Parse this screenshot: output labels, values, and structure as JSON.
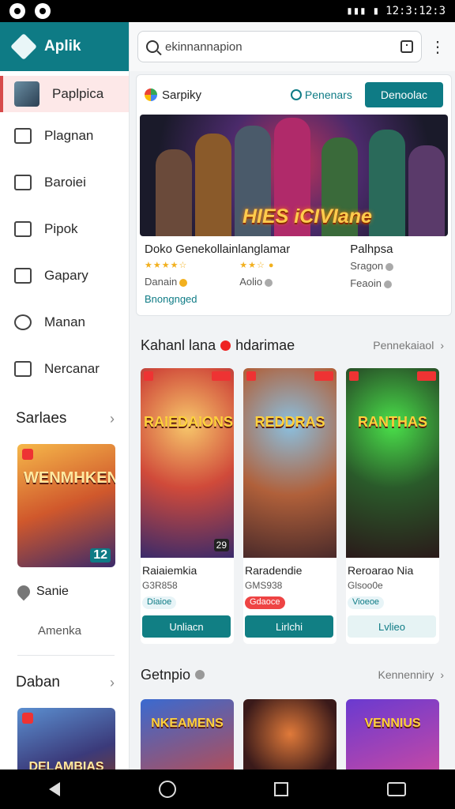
{
  "status": {
    "time": "12:3:12:3"
  },
  "sidebar": {
    "app_name": "Aplik",
    "items": [
      {
        "label": "Paplpica",
        "icon": "avatar-icon"
      },
      {
        "label": "Plagnan",
        "icon": "grid-icon"
      },
      {
        "label": "Baroiei",
        "icon": "store-icon"
      },
      {
        "label": "Pipok",
        "icon": "calendar-icon"
      },
      {
        "label": "Gapary",
        "icon": "home-icon"
      },
      {
        "label": "Manan",
        "icon": "search-icon"
      },
      {
        "label": "Nercanar",
        "icon": "house-icon"
      }
    ],
    "section1": {
      "title": "Sarlaes",
      "card_title": "WENMHKEN",
      "card_badge": "12",
      "line": "Sanie",
      "sub": "Amenka"
    },
    "section2": {
      "title": "Daban",
      "card_title": "DELAMBIAS"
    }
  },
  "search": {
    "text": "ekinnannapion"
  },
  "featured": {
    "header": "Sarpiky",
    "link": "Penenars",
    "button": "Denoolac",
    "hero_title": "HIES iCIVIane",
    "col1": {
      "title": "Doko Genekollainlanglamar",
      "meta": "Danain",
      "link": "Bnongnged"
    },
    "col2": {
      "meta": "Aolio"
    },
    "col3": {
      "title": "Palhpsa",
      "meta1": "Sragon",
      "meta2": "Feaoin"
    }
  },
  "section_a": {
    "title_left": "Kahanl lana",
    "title_right": "hdarimae",
    "more": "Pennekaiaol",
    "cards": [
      {
        "art_title": "RAIEDAIONS",
        "name": "Raiaiemkia",
        "meta": "G3R858",
        "chip": "Diaioe",
        "cta": "Unliacn",
        "num": "29"
      },
      {
        "art_title": "REDDRAS",
        "name": "Raradendie",
        "meta": "GMS938",
        "chip": "Gdaoce",
        "cta": "Lirlchi",
        "num": ""
      },
      {
        "art_title": "RANTHAS",
        "name": "Reroarao Nia",
        "meta": "Glsoo0e",
        "chip": "Vioeoe",
        "cta": "Lvlieo",
        "num": ""
      }
    ]
  },
  "section_b": {
    "title": "Getnpio",
    "more": "Kennenniry",
    "cards": [
      {
        "art_title": "NKEAMENS"
      },
      {
        "art_title": ""
      },
      {
        "art_title": "VENNIUS"
      }
    ]
  }
}
